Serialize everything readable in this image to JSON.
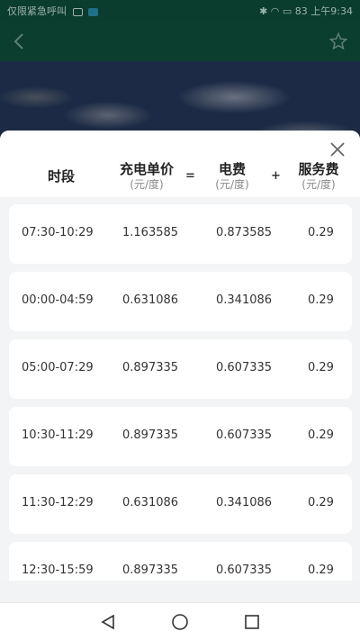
{
  "status_bar": {
    "left_text": "仅限紧急呼叫",
    "time": "上午9:34",
    "battery": "83"
  },
  "app_bar": {
    "back_icon": "chevron-left-icon",
    "favorite_icon": "star-outline-icon"
  },
  "sheet": {
    "close_icon": "close-icon",
    "columns": {
      "period": "时段",
      "unit_price": "充电单价",
      "unit_price_unit": "(元/度)",
      "equals": "=",
      "electricity": "电费",
      "electricity_unit": "(元/度)",
      "plus": "+",
      "service": "服务费",
      "service_unit": "(元/度)"
    },
    "rows": [
      {
        "period": "07:30-10:29",
        "price": "1.163585",
        "electricity": "0.873585",
        "service": "0.29"
      },
      {
        "period": "00:00-04:59",
        "price": "0.631086",
        "electricity": "0.341086",
        "service": "0.29"
      },
      {
        "period": "05:00-07:29",
        "price": "0.897335",
        "electricity": "0.607335",
        "service": "0.29"
      },
      {
        "period": "10:30-11:29",
        "price": "0.897335",
        "electricity": "0.607335",
        "service": "0.29"
      },
      {
        "period": "11:30-12:29",
        "price": "0.631086",
        "electricity": "0.341086",
        "service": "0.29"
      },
      {
        "period": "12:30-15:59",
        "price": "0.897335",
        "electricity": "0.607335",
        "service": "0.29"
      }
    ]
  },
  "nav_bar": {
    "back": "triangle-back-icon",
    "home": "circle-home-icon",
    "recents": "square-recents-icon"
  }
}
